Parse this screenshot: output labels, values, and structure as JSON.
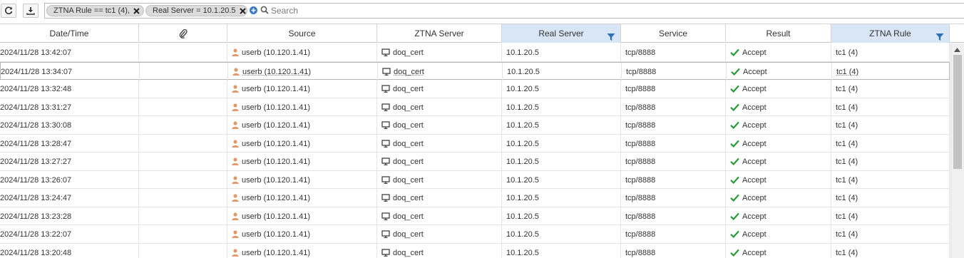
{
  "toolbar": {
    "refresh_icon": "refresh-icon",
    "download_icon": "download-icon"
  },
  "filters": {
    "chips": [
      {
        "label": "ZTNA Rule == tc1 (4),"
      },
      {
        "label": "Real Server = 10.1.20.5"
      }
    ],
    "search_placeholder": "Search"
  },
  "columns": {
    "datetime": "Date/Time",
    "attachment_icon": "paperclip-icon",
    "source": "Source",
    "ztna_server": "ZTNA Server",
    "real_server": "Real Server",
    "service": "Service",
    "result": "Result",
    "ztna_rule": "ZTNA Rule"
  },
  "colors": {
    "filter_header": "#d8e6f5",
    "funnel": "#2f6fb3",
    "user_icon": "#e09a6a",
    "accept_check": "#2a9a3a"
  },
  "rows": [
    {
      "datetime": "2024/11/28 13:42:07",
      "source": "userb (10.120.1.41)",
      "ztna_server": "doq_cert",
      "real_server": "10.1.20.5",
      "service": "tcp/8888",
      "result": "Accept",
      "ztna_rule": "tc1 (4)"
    },
    {
      "datetime": "2024/11/28 13:34:07",
      "source": "userb (10.120.1.41)",
      "ztna_server": "doq_cert",
      "real_server": "10.1.20.5",
      "service": "tcp/8888",
      "result": "Accept",
      "ztna_rule": "tc1 (4)"
    },
    {
      "datetime": "2024/11/28 13:32:48",
      "source": "userb (10.120.1.41)",
      "ztna_server": "doq_cert",
      "real_server": "10.1.20.5",
      "service": "tcp/8888",
      "result": "Accept",
      "ztna_rule": "tc1 (4)"
    },
    {
      "datetime": "2024/11/28 13:31:27",
      "source": "userb (10.120.1.41)",
      "ztna_server": "doq_cert",
      "real_server": "10.1.20.5",
      "service": "tcp/8888",
      "result": "Accept",
      "ztna_rule": "tc1 (4)"
    },
    {
      "datetime": "2024/11/28 13:30:08",
      "source": "userb (10.120.1.41)",
      "ztna_server": "doq_cert",
      "real_server": "10.1.20.5",
      "service": "tcp/8888",
      "result": "Accept",
      "ztna_rule": "tc1 (4)"
    },
    {
      "datetime": "2024/11/28 13:28:47",
      "source": "userb (10.120.1.41)",
      "ztna_server": "doq_cert",
      "real_server": "10.1.20.5",
      "service": "tcp/8888",
      "result": "Accept",
      "ztna_rule": "tc1 (4)"
    },
    {
      "datetime": "2024/11/28 13:27:27",
      "source": "userb (10.120.1.41)",
      "ztna_server": "doq_cert",
      "real_server": "10.1.20.5",
      "service": "tcp/8888",
      "result": "Accept",
      "ztna_rule": "tc1 (4)"
    },
    {
      "datetime": "2024/11/28 13:26:07",
      "source": "userb (10.120.1.41)",
      "ztna_server": "doq_cert",
      "real_server": "10.1.20.5",
      "service": "tcp/8888",
      "result": "Accept",
      "ztna_rule": "tc1 (4)"
    },
    {
      "datetime": "2024/11/28 13:24:47",
      "source": "userb (10.120.1.41)",
      "ztna_server": "doq_cert",
      "real_server": "10.1.20.5",
      "service": "tcp/8888",
      "result": "Accept",
      "ztna_rule": "tc1 (4)"
    },
    {
      "datetime": "2024/11/28 13:23:28",
      "source": "userb (10.120.1.41)",
      "ztna_server": "doq_cert",
      "real_server": "10.1.20.5",
      "service": "tcp/8888",
      "result": "Accept",
      "ztna_rule": "tc1 (4)"
    },
    {
      "datetime": "2024/11/28 13:22:07",
      "source": "userb (10.120.1.41)",
      "ztna_server": "doq_cert",
      "real_server": "10.1.20.5",
      "service": "tcp/8888",
      "result": "Accept",
      "ztna_rule": "tc1 (4)"
    },
    {
      "datetime": "2024/11/28 13:20:48",
      "source": "userb (10.120.1.41)",
      "ztna_server": "doq_cert",
      "real_server": "10.1.20.5",
      "service": "tcp/8888",
      "result": "Accept",
      "ztna_rule": "tc1 (4)"
    }
  ]
}
